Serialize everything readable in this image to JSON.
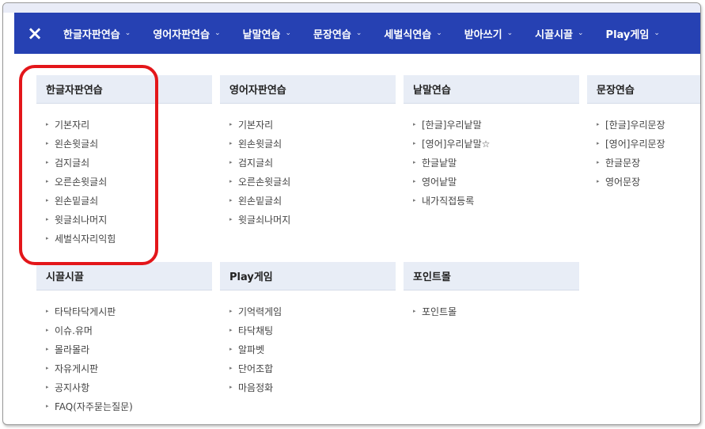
{
  "nav": {
    "close_icon": "×",
    "items": [
      {
        "label": "한글자판연습",
        "chevron": "⌄"
      },
      {
        "label": "영어자판연습",
        "chevron": "⌄"
      },
      {
        "label": "낱말연습",
        "chevron": "⌄"
      },
      {
        "label": "문장연습",
        "chevron": "⌄"
      },
      {
        "label": "세벌식연습",
        "chevron": "⌄"
      },
      {
        "label": "받아쓰기",
        "chevron": "⌄"
      },
      {
        "label": "시끌시끌",
        "chevron": "⌄"
      },
      {
        "label": "Play게임",
        "chevron": "⌄"
      }
    ]
  },
  "menu": {
    "bullet": "▸",
    "columns": [
      {
        "title": "한글자판연습",
        "items": [
          "기본자리",
          "왼손윗글쇠",
          "검지글쇠",
          "오른손윗글쇠",
          "왼손밑글쇠",
          "윗글쇠나머지",
          "세벌식자리익힘"
        ]
      },
      {
        "title": "영어자판연습",
        "items": [
          "기본자리",
          "왼손윗글쇠",
          "검지글쇠",
          "오른손윗글쇠",
          "왼손밑글쇠",
          "윗글쇠나머지"
        ]
      },
      {
        "title": "낱말연습",
        "items": [
          "[한글]우리낱말",
          "[영어]우리낱말☆",
          "한글낱말",
          "영어낱말",
          "내가직접등록"
        ]
      },
      {
        "title": "문장연습",
        "items": [
          "[한글]우리문장",
          "[영어]우리문장",
          "한글문장",
          "영어문장"
        ]
      },
      {
        "title": "시끌시끌",
        "items": [
          "타닥타닥게시판",
          "이슈.유머",
          "몰라몰라",
          "자유게시판",
          "공지사항",
          "FAQ(자주묻는질문)"
        ]
      },
      {
        "title": "Play게임",
        "items": [
          "기억력게임",
          "타닥채팅",
          "알파벳",
          "단어조합",
          "마음정화"
        ]
      },
      {
        "title": "포인트몰",
        "items": [
          "포인트몰"
        ]
      }
    ]
  },
  "colors": {
    "navbar": "#2641b3",
    "header_bg": "#e8edf6",
    "highlight": "#e3161a"
  }
}
